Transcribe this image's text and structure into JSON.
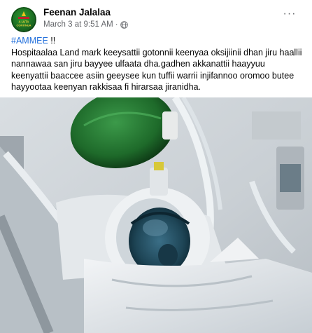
{
  "post": {
    "author": "Feenan Jalalaa",
    "avatar_text": "A LUTA CONTINUA",
    "date": "March 3 at 9:51 AM",
    "separator": "·",
    "privacy_icon": "globe-icon",
    "more_icon": "more-options-icon",
    "more_label": "···",
    "hashtag": "#AMMEE",
    "hashtag_suffix": " !!",
    "body_text": "Hospitaalaa Land mark keeysattii gotonnii keenyaa oksijiinii dhan jiru haallii nannawaa san jiru bayyee ulfaata dha.gadhen akkanattii haayyuu keenyattii baaccee asiin geeysee kun tuffii warrii injifannoo oromoo butee hayyootaa keenyan rakkisaa fi hirarsaa jiranidha."
  },
  "colors": {
    "link": "#216fdb",
    "secondary_text": "#65676b",
    "avatar_green": "#1b6b22"
  }
}
